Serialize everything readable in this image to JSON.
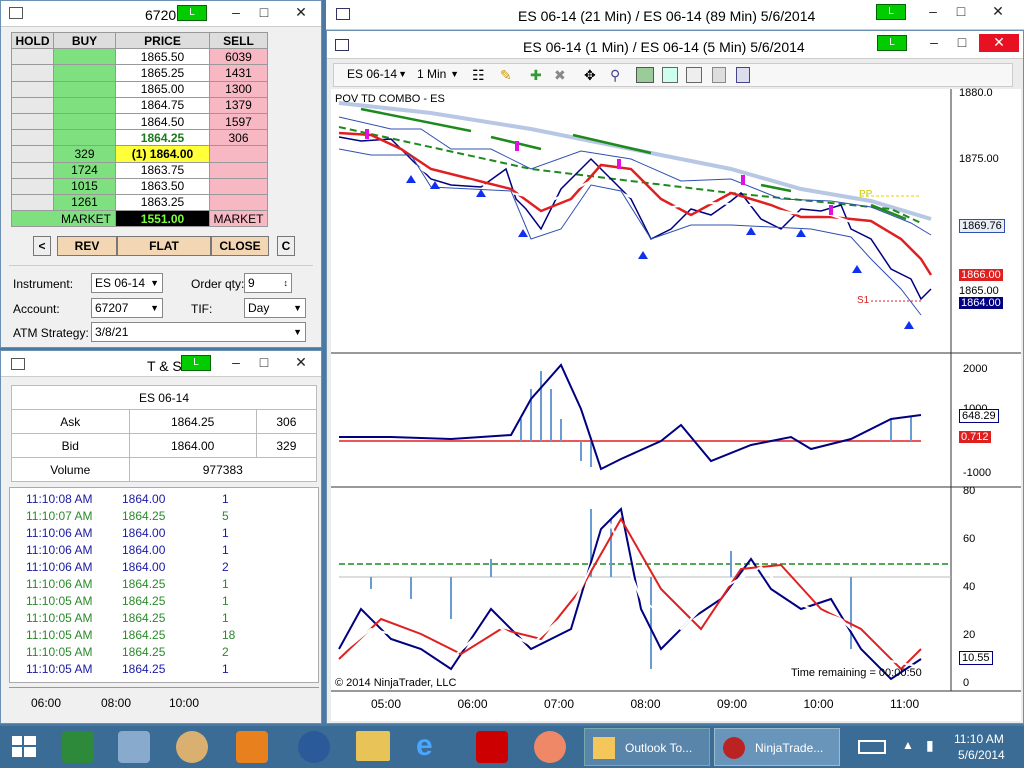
{
  "dom": {
    "title": "6720",
    "hold": "HOLD",
    "buy": "BUY",
    "price": "PRICE",
    "sell": "SELL",
    "rows": [
      {
        "buy": "",
        "price": "1865.50",
        "sell": "6039",
        "hl": ""
      },
      {
        "buy": "",
        "price": "1865.25",
        "sell": "1431",
        "hl": ""
      },
      {
        "buy": "",
        "price": "1865.00",
        "sell": "1300",
        "hl": ""
      },
      {
        "buy": "",
        "price": "1864.75",
        "sell": "1379",
        "hl": ""
      },
      {
        "buy": "",
        "price": "1864.50",
        "sell": "1597",
        "hl": ""
      },
      {
        "buy": "",
        "price": "1864.25",
        "sell": "306",
        "hl": "ask"
      },
      {
        "buy": "329",
        "price": "(1) 1864.00",
        "sell": "",
        "hl": "bid"
      },
      {
        "buy": "1724",
        "price": "1863.75",
        "sell": "",
        "hl": ""
      },
      {
        "buy": "1015",
        "price": "1863.50",
        "sell": "",
        "hl": ""
      },
      {
        "buy": "1261",
        "price": "1863.25",
        "sell": "",
        "hl": ""
      }
    ],
    "market": "MARKET",
    "last": "1551.00",
    "market2": "MARKET",
    "lt": "<",
    "rev": "REV",
    "flat": "FLAT",
    "close": "CLOSE",
    "c": "C",
    "instrument_label": "Instrument:",
    "instrument": "ES 06-14",
    "orderqty_label": "Order qty:",
    "orderqty": "9",
    "account_label": "Account:",
    "account": "67207",
    "tif_label": "TIF:",
    "tif": "Day",
    "atm_label": "ATM Strategy:",
    "atm": "3/8/21"
  },
  "ts": {
    "title": "T & S",
    "instrument": "ES 06-14",
    "ask_label": "Ask",
    "ask": "1864.25",
    "ask_size": "306",
    "bid_label": "Bid",
    "bid": "1864.00",
    "bid_size": "329",
    "vol_label": "Volume",
    "volume": "977383",
    "trades": [
      {
        "t": "11:10:08 AM",
        "p": "1864.00",
        "s": "1",
        "c": "#1a1aa6"
      },
      {
        "t": "11:10:07 AM",
        "p": "1864.25",
        "s": "5",
        "c": "#2a8a2a"
      },
      {
        "t": "11:10:06 AM",
        "p": "1864.00",
        "s": "1",
        "c": "#1a1aa6"
      },
      {
        "t": "11:10:06 AM",
        "p": "1864.00",
        "s": "1",
        "c": "#1a1aa6"
      },
      {
        "t": "11:10:06 AM",
        "p": "1864.00",
        "s": "2",
        "c": "#1a1aa6"
      },
      {
        "t": "11:10:06 AM",
        "p": "1864.25",
        "s": "1",
        "c": "#2a8a2a"
      },
      {
        "t": "11:10:05 AM",
        "p": "1864.25",
        "s": "1",
        "c": "#2a8a2a"
      },
      {
        "t": "11:10:05 AM",
        "p": "1864.25",
        "s": "1",
        "c": "#2a8a2a"
      },
      {
        "t": "11:10:05 AM",
        "p": "1864.25",
        "s": "18",
        "c": "#2a8a2a"
      },
      {
        "t": "11:10:05 AM",
        "p": "1864.25",
        "s": "2",
        "c": "#2a8a2a"
      },
      {
        "t": "11:10:05 AM",
        "p": "1864.25",
        "s": "1",
        "c": "#1a1aa6"
      }
    ],
    "axis": [
      "06:00",
      "08:00",
      "10:00"
    ]
  },
  "chart": {
    "outer_title": "ES 06-14 (21 Min) / ES 06-14 (89 Min)  5/6/2014",
    "inner_title": "ES 06-14 (1 Min) / ES 06-14 (5 Min)  5/6/2014",
    "instrument": "ES 06-14",
    "interval": "1 Min",
    "indicator": "POV TD COMBO - ES",
    "pp": "PP",
    "s1": "S1",
    "copyright": "© 2014 NinjaTrader, LLC",
    "time_remaining": "Time remaining = 00:00:50",
    "y1": [
      "1880.0",
      "1875.00",
      "1865.00"
    ],
    "y1tags": [
      "1869.76",
      "1866.00",
      "1864.00"
    ],
    "y2": [
      "2000",
      "1000",
      "-1000"
    ],
    "y2tags": [
      "648.29",
      "0.712"
    ],
    "y3": [
      "80",
      "60",
      "40",
      "20",
      "0"
    ],
    "y3tag": "10.55",
    "xaxis": [
      "05:00",
      "06:00",
      "07:00",
      "08:00",
      "09:00",
      "10:00",
      "11:00"
    ]
  },
  "taskbar": {
    "outlook": "Outlook To...",
    "ninja": "NinjaTrade...",
    "time": "11:10 AM",
    "date": "5/6/2014"
  }
}
